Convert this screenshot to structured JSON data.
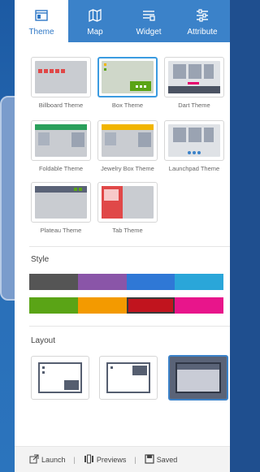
{
  "tabs": [
    {
      "label": "Theme",
      "icon": "theme-icon",
      "active": true
    },
    {
      "label": "Map",
      "icon": "map-icon",
      "active": false
    },
    {
      "label": "Widget",
      "icon": "widget-icon",
      "active": false
    },
    {
      "label": "Attribute",
      "icon": "attribute-icon",
      "active": false
    }
  ],
  "themes": [
    {
      "label": "Billboard Theme"
    },
    {
      "label": "Box Theme",
      "selected": true
    },
    {
      "label": "Dart Theme"
    },
    {
      "label": "Foldable Theme"
    },
    {
      "label": "Jewelry Box Theme"
    },
    {
      "label": "Launchpad Theme"
    },
    {
      "label": "Plateau Theme"
    },
    {
      "label": "Tab Theme"
    }
  ],
  "style": {
    "title": "Style",
    "row1": [
      "#555555",
      "#8a55a8",
      "#2f78d6",
      "#2aa6d9"
    ],
    "row2": [
      "#5aa416",
      "#f39a00",
      "#c1141e",
      "#e8158b"
    ],
    "selected_color": "#c1141e"
  },
  "layout": {
    "title": "Layout",
    "selected_index": 2
  },
  "footer": {
    "launch": "Launch",
    "previews": "Previews",
    "saved": "Saved"
  },
  "colors": {
    "accent": "#3b82c9",
    "panel_bg": "#ffffff"
  }
}
